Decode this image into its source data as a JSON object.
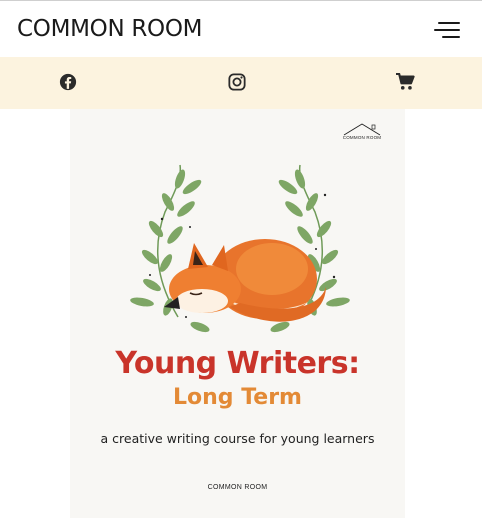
{
  "header": {
    "brand": "COMMON ROOM",
    "menu_icon": "hamburger-menu-icon"
  },
  "social_bar": {
    "background": "#fcf3df",
    "icons": [
      "facebook-icon",
      "instagram-icon",
      "shopping-cart-icon"
    ]
  },
  "cover": {
    "logo_text": "COMMON ROOM",
    "title": "Young Writers:",
    "subtitle": "Long Term",
    "tagline": "a creative writing course for young learners",
    "publisher": "COMMON ROOM",
    "illustration": "sleeping-fox-with-leaf-wreath",
    "colors": {
      "title": "#c9342a",
      "subtitle": "#e38a36",
      "leaf": "#7ea665",
      "fox": "#e8742c"
    }
  }
}
